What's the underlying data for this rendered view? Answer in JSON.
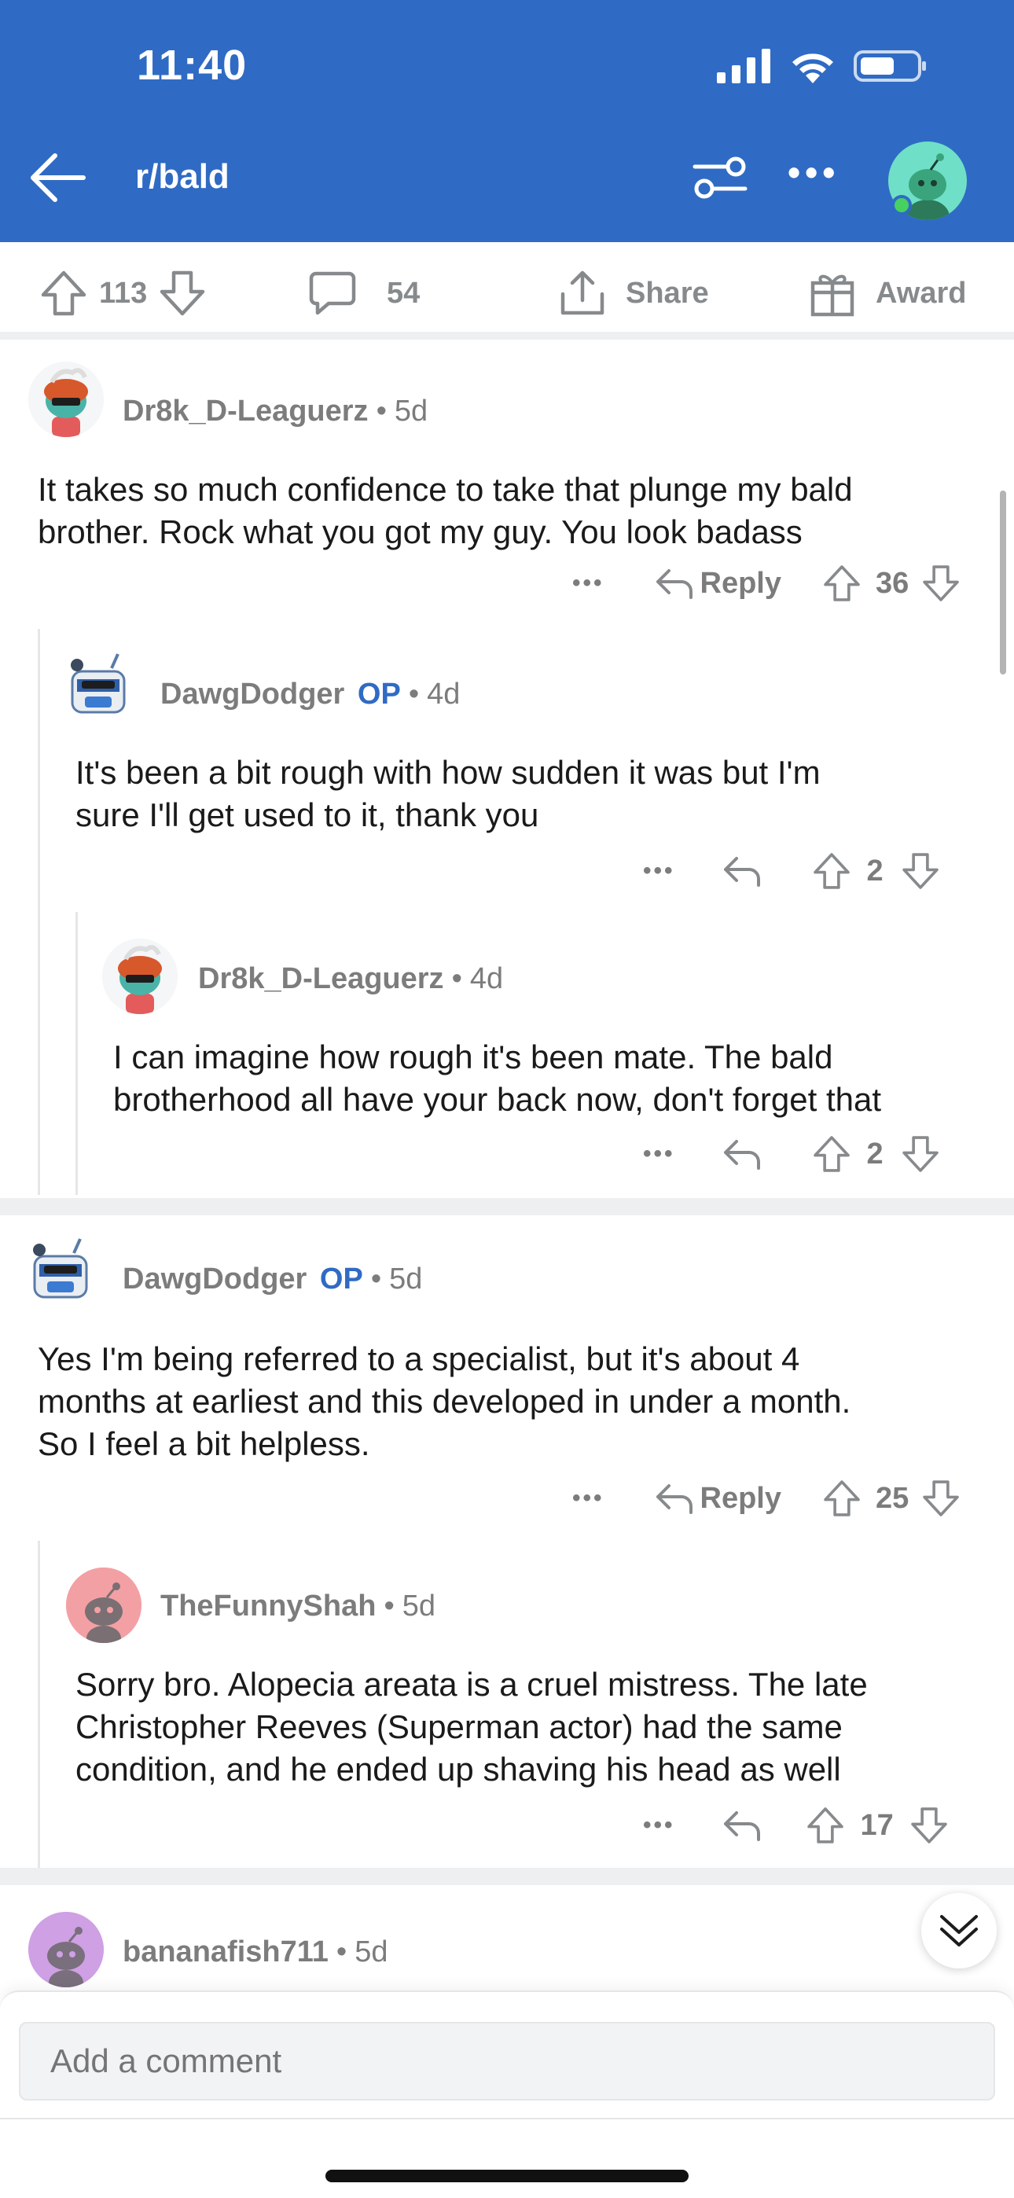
{
  "status_bar": {
    "time": "11:40"
  },
  "header": {
    "subreddit": "r/bald"
  },
  "post_actions": {
    "votes": "113",
    "comments": "54",
    "share": "Share",
    "award": "Award"
  },
  "comments": [
    {
      "author": "Dr8k_D-Leaguerz",
      "op": "",
      "age": "5d",
      "lines": [
        "It takes so much confidence to take that plunge my bald",
        "brother. Rock what you got my guy. You look badass"
      ],
      "reply": "Reply",
      "score": "36"
    },
    {
      "author": "DawgDodger",
      "op": "OP",
      "age": "4d",
      "lines": [
        "It's been a bit rough with how sudden it was but I'm",
        "sure I'll get used to it, thank you"
      ],
      "score": "2"
    },
    {
      "author": "Dr8k_D-Leaguerz",
      "op": "",
      "age": "4d",
      "lines": [
        "I can imagine how rough it's been mate. The bald",
        "brotherhood all have your back now, don't forget that"
      ],
      "score": "2"
    },
    {
      "author": "DawgDodger",
      "op": "OP",
      "age": "5d",
      "lines": [
        "Yes I'm being referred to a specialist, but it's about 4",
        "months at earliest and this developed in under a month.",
        "So I feel a bit helpless."
      ],
      "reply": "Reply",
      "score": "25"
    },
    {
      "author": "TheFunnyShah",
      "op": "",
      "age": "5d",
      "lines": [
        "Sorry bro. Alopecia areata is a cruel mistress. The late",
        "Christopher Reeves (Superman actor) had the same",
        "condition, and he ended up shaving his head as well"
      ],
      "score": "17"
    },
    {
      "author": "bananafish711",
      "op": "",
      "age": "5d"
    }
  ],
  "composer": {
    "placeholder": "Add a comment"
  },
  "colors": {
    "header": "#2f6bc4",
    "op_badge": "#2f6bc4",
    "meta": "#7c7c7c"
  },
  "icons": [
    "back-arrow-icon",
    "filter-icon",
    "more-icon",
    "upvote-icon",
    "downvote-icon",
    "comment-icon",
    "share-icon",
    "award-icon",
    "reply-icon",
    "chevrons-down-icon"
  ]
}
